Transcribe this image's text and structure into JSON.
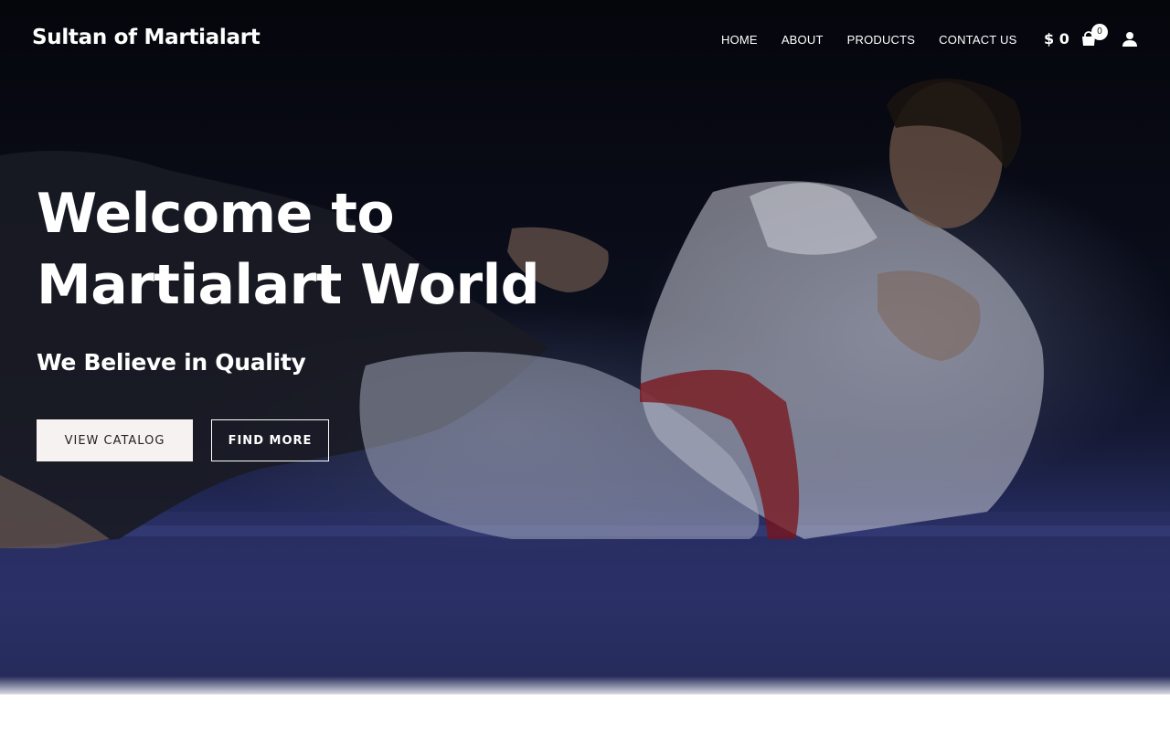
{
  "header": {
    "site_title": "Sultan of Martialart",
    "nav": [
      {
        "label": "HOME"
      },
      {
        "label": "ABOUT"
      },
      {
        "label": "PRODUCTS"
      },
      {
        "label": "CONTACT US"
      }
    ],
    "cart_amount": "$ 0",
    "cart_count": "0",
    "icons": {
      "cart": "shopping-bag-icon",
      "user": "user-icon"
    }
  },
  "hero": {
    "title": "Welcome to Martialart World",
    "subtitle": "We Believe in Quality",
    "buttons": {
      "catalog": "VIEW CATALOG",
      "find_more": "FIND MORE"
    }
  },
  "colors": {
    "background_dark": "#0b0e1c",
    "mat_blue": "#2a3168",
    "text": "#ffffff",
    "catalog_button_bg": "#f7f2f2"
  }
}
